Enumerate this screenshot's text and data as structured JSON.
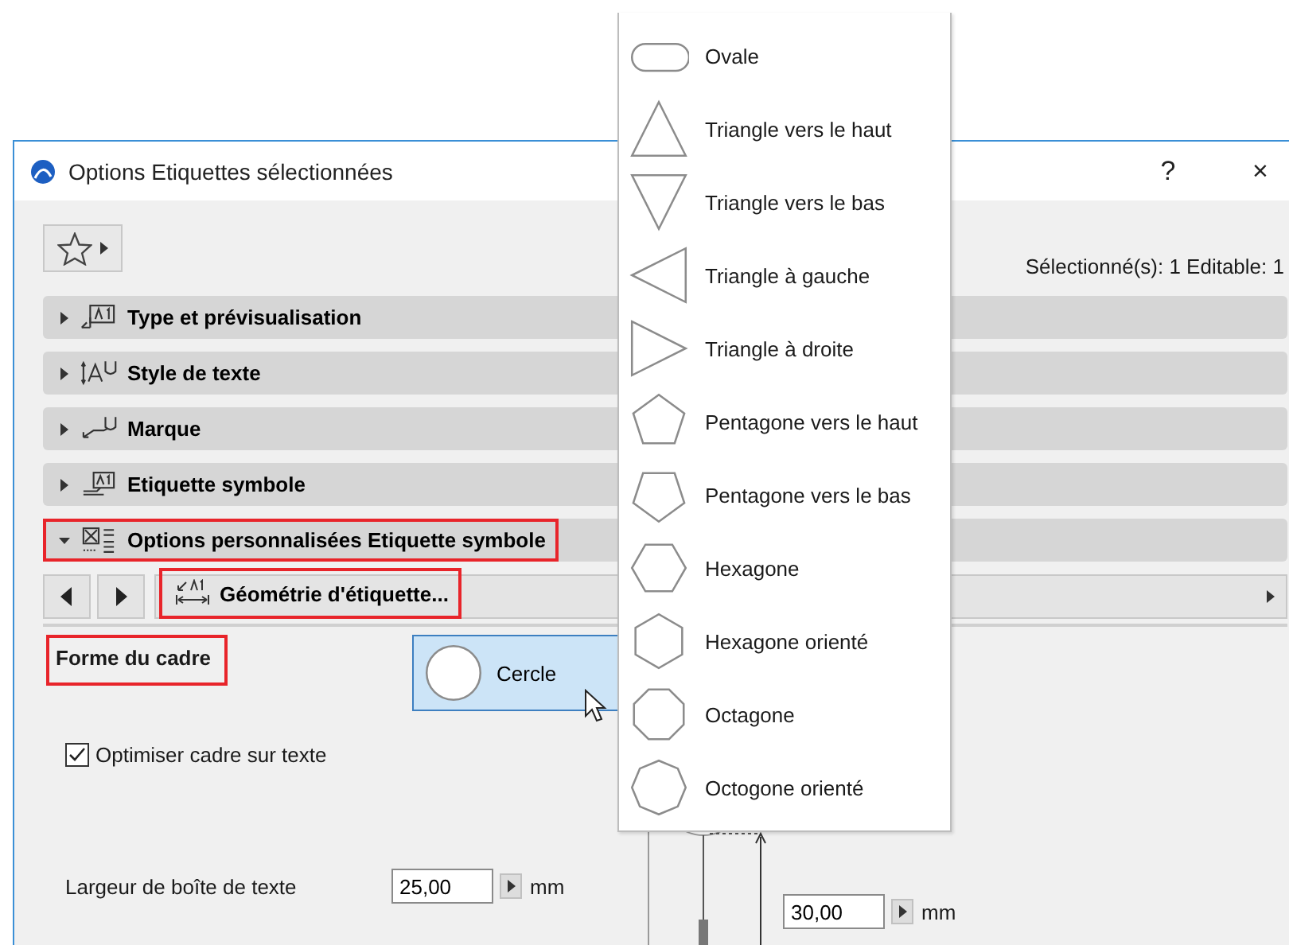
{
  "window": {
    "title": "Options Etiquettes sélectionnées",
    "help": "?",
    "close": "×"
  },
  "toolbar": {
    "selection_info": "Sélectionné(s): 1 Editable: 1"
  },
  "sections": [
    {
      "label": "Type et prévisualisation",
      "expanded": false,
      "highlighted": false
    },
    {
      "label": "Style de texte",
      "expanded": false,
      "highlighted": false
    },
    {
      "label": "Marque",
      "expanded": false,
      "highlighted": false
    },
    {
      "label": "Etiquette symbole",
      "expanded": false,
      "highlighted": false
    },
    {
      "label": "Options personnalisées Etiquette symbole",
      "expanded": true,
      "highlighted": true
    }
  ],
  "page_selector": {
    "label": "Géométrie d'étiquette...",
    "highlighted": true
  },
  "frame_shape": {
    "label": "Forme du cadre",
    "highlighted": true,
    "value": "Cercle",
    "kind": "circle"
  },
  "fit_frame": {
    "label": "Optimiser cadre sur texte",
    "checked": true
  },
  "text_box_width": {
    "label": "Largeur de boîte de texte",
    "value": "25,00",
    "unit": "mm"
  },
  "preview": {
    "height_value": "30,00",
    "unit": "mm"
  },
  "shape_menu": [
    {
      "label": "Ovale",
      "kind": "oval"
    },
    {
      "label": "Triangle vers le haut",
      "kind": "triangle-up"
    },
    {
      "label": "Triangle vers le bas",
      "kind": "triangle-down"
    },
    {
      "label": "Triangle à gauche",
      "kind": "triangle-left"
    },
    {
      "label": "Triangle à droite",
      "kind": "triangle-right"
    },
    {
      "label": "Pentagone vers le haut",
      "kind": "pentagon-up"
    },
    {
      "label": "Pentagone vers le bas",
      "kind": "pentagon-down"
    },
    {
      "label": "Hexagone",
      "kind": "hexagon"
    },
    {
      "label": "Hexagone orienté",
      "kind": "hexagon-rotated"
    },
    {
      "label": "Octagone",
      "kind": "octagon"
    },
    {
      "label": "Octogone orienté",
      "kind": "octagon-rotated"
    }
  ]
}
